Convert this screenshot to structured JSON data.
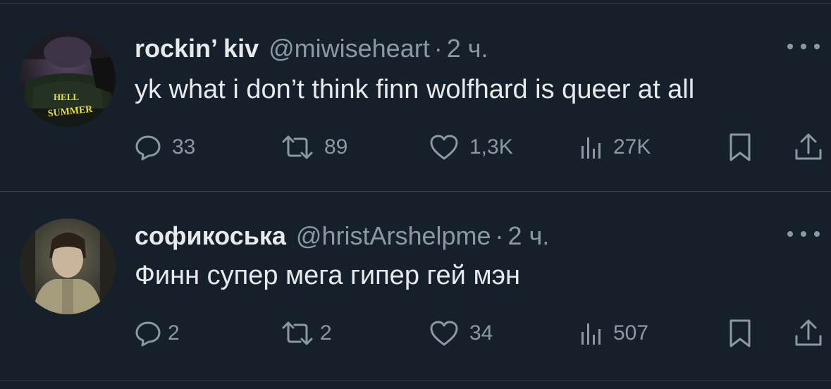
{
  "tweets": [
    {
      "name": "rockin’ kiv",
      "handle": "@miwiseheart",
      "dot": "·",
      "time": "2 ч.",
      "text": "yk what i don’t think finn wolfhard is queer at all",
      "avatar_text_1": "HELL",
      "avatar_text_2": "SUMMER",
      "replies": "33",
      "retweets": "89",
      "likes": "1,3K",
      "views": "27K"
    },
    {
      "name": "софикоська",
      "handle": "@hristArshelpme",
      "dot": "·",
      "time": "2 ч.",
      "text": "Финн супер мега гипер гей мэн",
      "replies": "2",
      "retweets": "2",
      "likes": "34",
      "views": "507"
    }
  ],
  "icons": {
    "reply": "reply-icon",
    "retweet": "retweet-icon",
    "like": "heart-icon",
    "views": "views-icon",
    "bookmark": "bookmark-icon",
    "share": "share-icon",
    "more": "more-icon"
  },
  "colors": {
    "background": "#15202b",
    "text": "#e7e9ea",
    "secondary": "#8b98a5",
    "divider": "#38444d"
  }
}
